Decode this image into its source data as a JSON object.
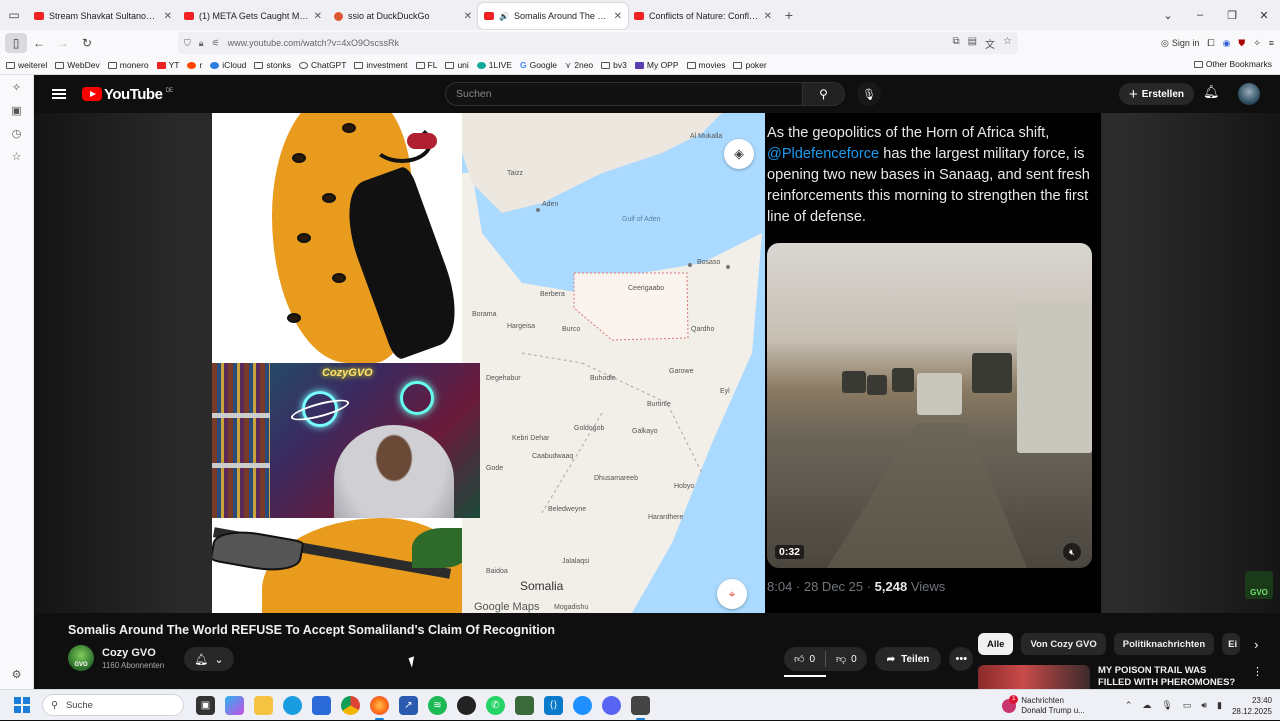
{
  "browser": {
    "tabs": [
      {
        "title": "Stream Shavkat Sultanov | Hor...",
        "favicon": "stream-icon",
        "active": false
      },
      {
        "title": "(1) META Gets Caught Manipul...",
        "favicon": "youtube-icon",
        "active": false
      },
      {
        "title": "ssio at DuckDuckGo",
        "favicon": "duckduckgo-icon",
        "active": false
      },
      {
        "title": "Somalis Around The World",
        "favicon": "youtube-icon",
        "active": true
      },
      {
        "title": "Conflicts of Nature: Conflicts in...",
        "favicon": "youtube-icon",
        "active": false
      }
    ],
    "new_tab": "+",
    "url": "www.youtube.com/watch?v=4xO9OscssRk",
    "sign_in": "Sign in",
    "bookmarks": [
      "weiterel",
      "WebDev",
      "monero",
      "YT",
      "r",
      "iCloud",
      "stonks",
      "ChatGPT",
      "investment",
      "FL",
      "uni",
      "1LIVE",
      "Google",
      "2neo",
      "bv3",
      "My OPP",
      "movies",
      "poker"
    ],
    "other_bookmarks": "Other Bookmarks"
  },
  "youtube": {
    "logo_text": "YouTube",
    "region": "DE",
    "search_placeholder": "Suchen",
    "create_label": "Erstellen",
    "video": {
      "map": {
        "labels": [
          "Al Mukalla",
          "Taizz",
          "Aden",
          "Gulf of Aden",
          "Bosaso",
          "Berbera",
          "Ceerigaabo",
          "Borama",
          "Hargeisa",
          "Burco",
          "Qardho",
          "Garowe",
          "Degehabur",
          "Buhodle",
          "Eyl",
          "Burtinle",
          "Kebri Dehar",
          "Goldogob",
          "Galkayo",
          "Gode",
          "Caabudwaaq",
          "Dhusamareeb",
          "Hobyo",
          "Beledweyne",
          "Harardhere",
          "Jalalaqsi",
          "Baidoa",
          "Somalia",
          "Mogadishu"
        ],
        "attribution_brand": "Google",
        "attribution_product": "Maps"
      },
      "webcam_neon_text": "CozyGVO",
      "tweet": {
        "text_before": "As the geopolitics of the Horn of Africa shift, ",
        "mention": "@Pldefenceforce",
        "text_after": " has the largest military force, is opening two new bases in Sanaag, and sent fresh reinforcements this morning to strengthen the first line of defense.",
        "media_duration": "0:32",
        "meta_time": "8:04 · 28 Dec 25 · ",
        "views_count": "5,248",
        "views_label": " Views"
      },
      "badge_text": "GVO"
    },
    "title": "Somalis Around The World REFUSE To Accept Somaliland's Claim Of Recognition",
    "channel": {
      "name": "Cozy GVO",
      "subscribers": "1160 Abonnenten",
      "avatar_text": "GVO"
    },
    "likes": "0",
    "dislikes": "0",
    "share_label": "Teilen",
    "chips": [
      "Alle",
      "Von Cozy GVO",
      "Politiknachrichten",
      "Ei"
    ],
    "recommendation_title": "MY POISON TRAIL WAS FILLED WITH PHEROMONES? THEY..."
  },
  "taskbar": {
    "search_placeholder": "Suche",
    "news_title": "Nachrichten",
    "news_text": "Donald Trump u...",
    "news_count": "1",
    "time": "23:40",
    "date": "28.12.2025"
  },
  "colors": {
    "youtube_red": "#ff0000",
    "mention_blue": "#1d9bf0",
    "background": "#0f0f0f"
  }
}
